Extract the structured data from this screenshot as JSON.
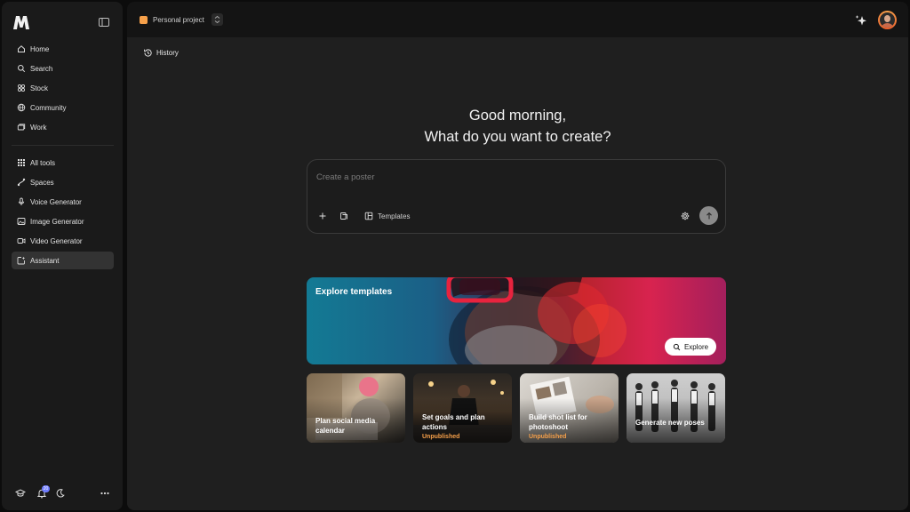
{
  "sidebar": {
    "nav_primary": [
      {
        "label": "Home",
        "icon": "home-icon"
      },
      {
        "label": "Search",
        "icon": "search-icon"
      },
      {
        "label": "Stock",
        "icon": "stock-icon"
      },
      {
        "label": "Community",
        "icon": "globe-icon"
      },
      {
        "label": "Work",
        "icon": "folders-icon"
      }
    ],
    "nav_secondary": [
      {
        "label": "All tools",
        "icon": "grid-icon"
      },
      {
        "label": "Spaces",
        "icon": "spaces-icon"
      },
      {
        "label": "Voice Generator",
        "icon": "microphone-icon"
      },
      {
        "label": "Image Generator",
        "icon": "image-icon"
      },
      {
        "label": "Video Generator",
        "icon": "video-icon"
      },
      {
        "label": "Assistant",
        "icon": "assistant-icon",
        "active": true
      }
    ],
    "notification_count": "20"
  },
  "topbar": {
    "project_name": "Personal project",
    "project_color": "#f6a04a"
  },
  "main": {
    "history_label": "History",
    "greeting_line1": "Good morning,",
    "greeting_line2": "What do you want to create?",
    "prompt_placeholder": "Create a poster",
    "templates_label": "Templates",
    "banner": {
      "title": "Explore templates",
      "button_label": "Explore"
    },
    "cards": [
      {
        "title": "Plan social media calendar",
        "status": ""
      },
      {
        "title": "Set goals and plan actions",
        "status": "Unpublished"
      },
      {
        "title": "Build shot list for photoshoot",
        "status": "Unpublished"
      },
      {
        "title": "Generate new poses",
        "status": ""
      }
    ]
  },
  "colors": {
    "accent": "#f6a04a",
    "sidebar_bg": "#1a1a1a",
    "main_bg": "#1f1f1f"
  }
}
